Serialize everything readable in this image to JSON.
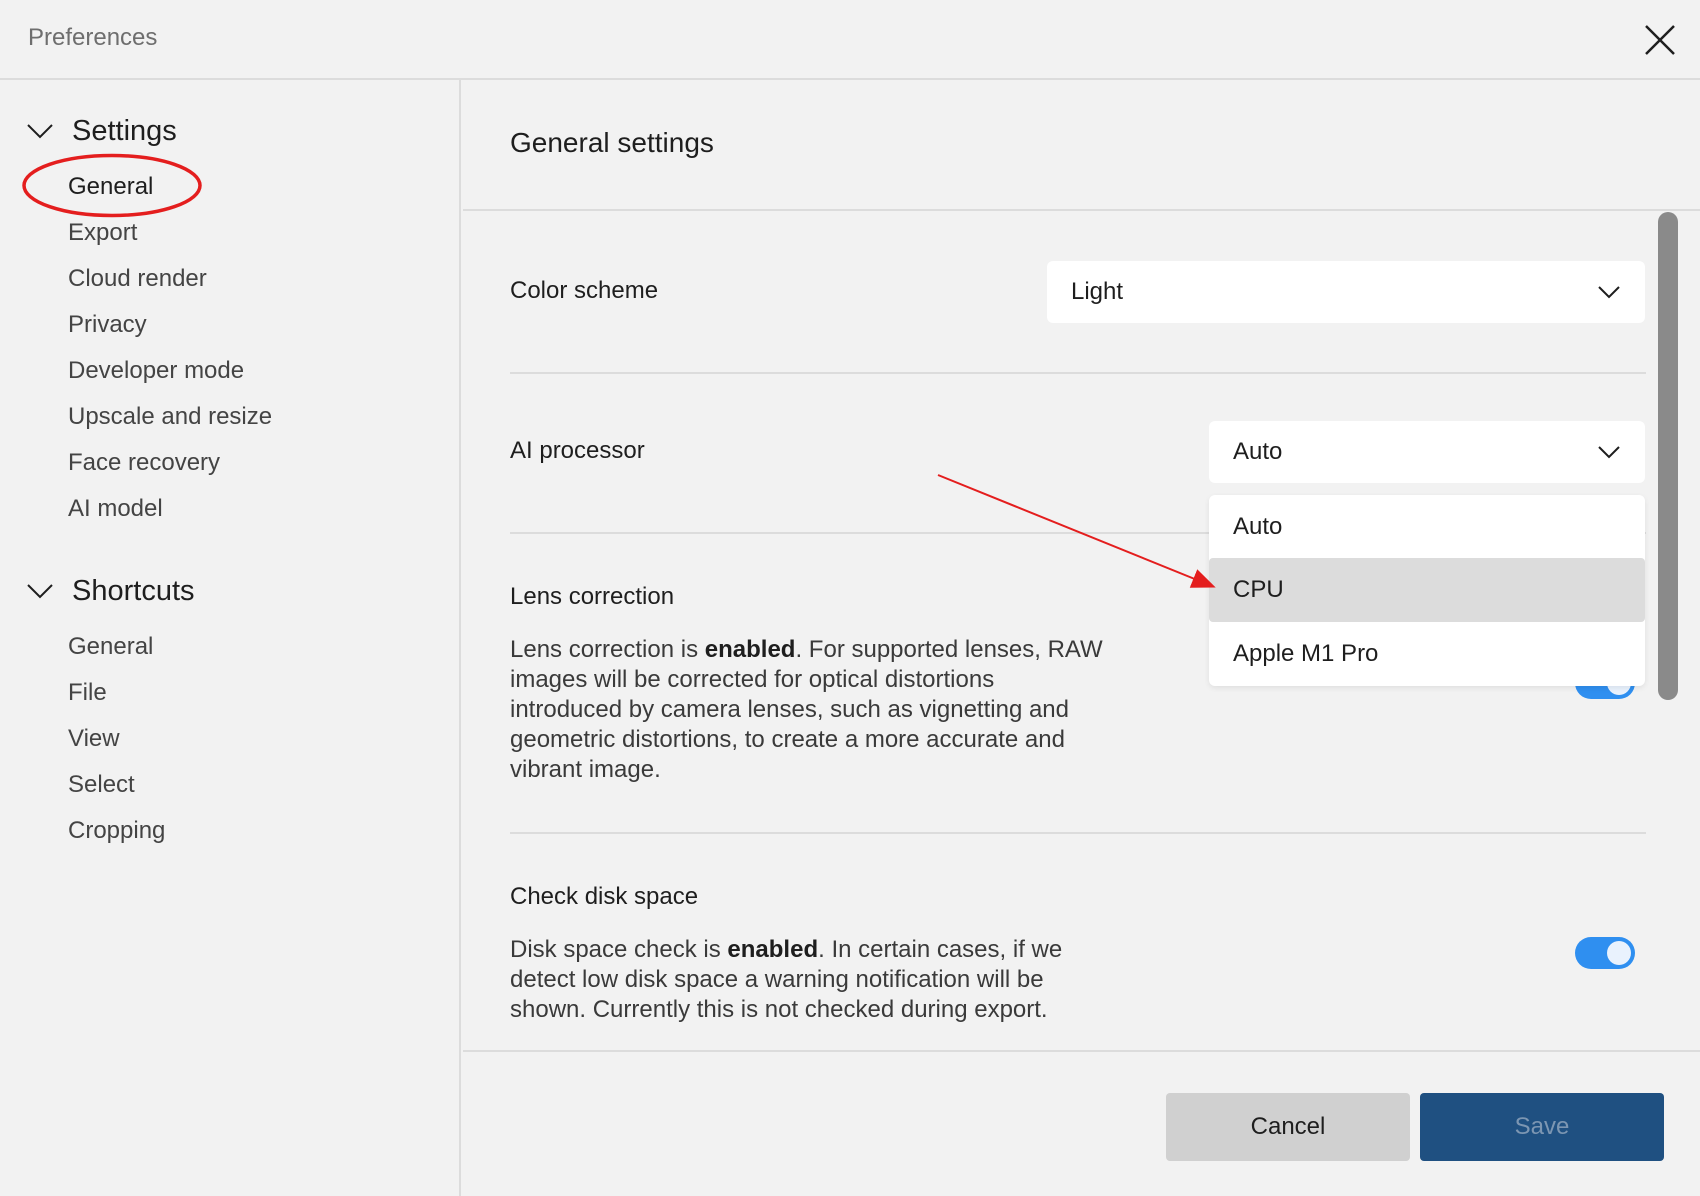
{
  "window": {
    "title": "Preferences"
  },
  "sidebar": {
    "groups": [
      {
        "label": "Settings",
        "items": [
          "General",
          "Export",
          "Cloud render",
          "Privacy",
          "Developer mode",
          "Upscale and resize",
          "Face recovery",
          "AI model"
        ]
      },
      {
        "label": "Shortcuts",
        "items": [
          "General",
          "File",
          "View",
          "Select",
          "Cropping"
        ]
      }
    ],
    "active_item": "Settings / General"
  },
  "main": {
    "title": "General settings",
    "color_scheme": {
      "label": "Color scheme",
      "value": "Light"
    },
    "ai_processor": {
      "label": "AI processor",
      "value": "Auto",
      "options": [
        "Auto",
        "CPU",
        "Apple M1 Pro"
      ],
      "hovered_option": "CPU"
    },
    "lens_correction": {
      "label": "Lens correction",
      "desc_pre": "Lens correction is ",
      "desc_bold": "enabled",
      "desc_post": ". For supported lenses, RAW images will be corrected for optical distortions introduced by camera lenses, such as vignetting and geometric distortions, to create a more accurate and vibrant image.",
      "enabled": true
    },
    "check_disk_space": {
      "label": "Check disk space",
      "desc_pre": "Disk space check is ",
      "desc_bold": "enabled",
      "desc_post": ". In certain cases, if we detect low disk space a warning notification will be shown. Currently this is not checked during export.",
      "enabled": true
    }
  },
  "footer": {
    "cancel_label": "Cancel",
    "save_label": "Save"
  },
  "colors": {
    "accent_toggle": "#2f8ff0",
    "save_button": "#1f5081",
    "annotation": "#e41e1e"
  },
  "icons": {
    "close": "close-icon",
    "chevron_group": "chevron-down-icon",
    "select_chevron": "chevron-down-icon"
  }
}
